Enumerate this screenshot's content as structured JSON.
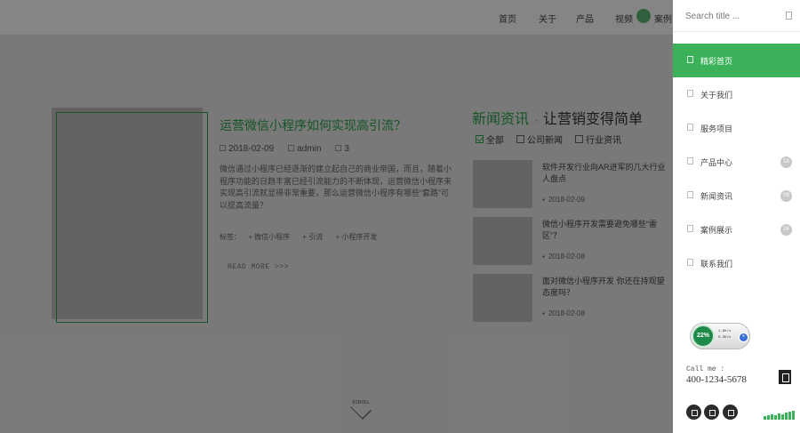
{
  "topnav": {
    "items": [
      "首页",
      "关于",
      "产品",
      "视频",
      "案例"
    ]
  },
  "article": {
    "title": "运营微信小程序如何实现高引流？",
    "date": "2018-02-09",
    "author": "admin",
    "comments": "3",
    "description": "微信通过小程序已经逐渐的建立起自己的商业帝国，而且，随着小程序功能的日趋丰富已经引流能力的不断体现，运营微信小程序来实现高引流就显得非常重要，那么运营微信小程序有哪些“套路”可以提高流量？",
    "tags_label": "标签：",
    "tags": [
      "微信小程序",
      "引流",
      "小程序开发"
    ],
    "read_more": "READ MORE >>>"
  },
  "news": {
    "heading_green": "新闻资讯",
    "heading_sep": "·",
    "heading_dark": "让营销变得简单",
    "tabs": [
      "全部",
      "公司新闻",
      "行业资讯"
    ],
    "items": [
      {
        "title": "软件开发行业向AR进军的几大行业人盘点",
        "date": "2018-02-09"
      },
      {
        "title": "微信小程序开发需要避免哪些“雷区”？",
        "date": "2018-02-08"
      },
      {
        "title": "面对微信小程序开发 你还在持观望态度吗？",
        "date": "2018-02-08"
      }
    ]
  },
  "scroll_label": "SCROLL",
  "sidebar": {
    "search_placeholder": "Search title ...",
    "menu": [
      {
        "label": "精彩首页",
        "active": true
      },
      {
        "label": "关于我们"
      },
      {
        "label": "服务项目"
      },
      {
        "label": "产品中心",
        "badge": "18"
      },
      {
        "label": "新闻资讯",
        "badge": "09"
      },
      {
        "label": "案例展示",
        "badge": "24"
      },
      {
        "label": "联系我们"
      }
    ],
    "stat_widget": {
      "percent": "22%",
      "line1": "1.8K/s",
      "line2": "0.3K/s",
      "dot": "+"
    },
    "call_label": "Call me :",
    "phone": "400-1234-5678"
  },
  "colors": {
    "accent": "#3bb15a",
    "overlay": "rgba(0,0,0,0.48)"
  }
}
